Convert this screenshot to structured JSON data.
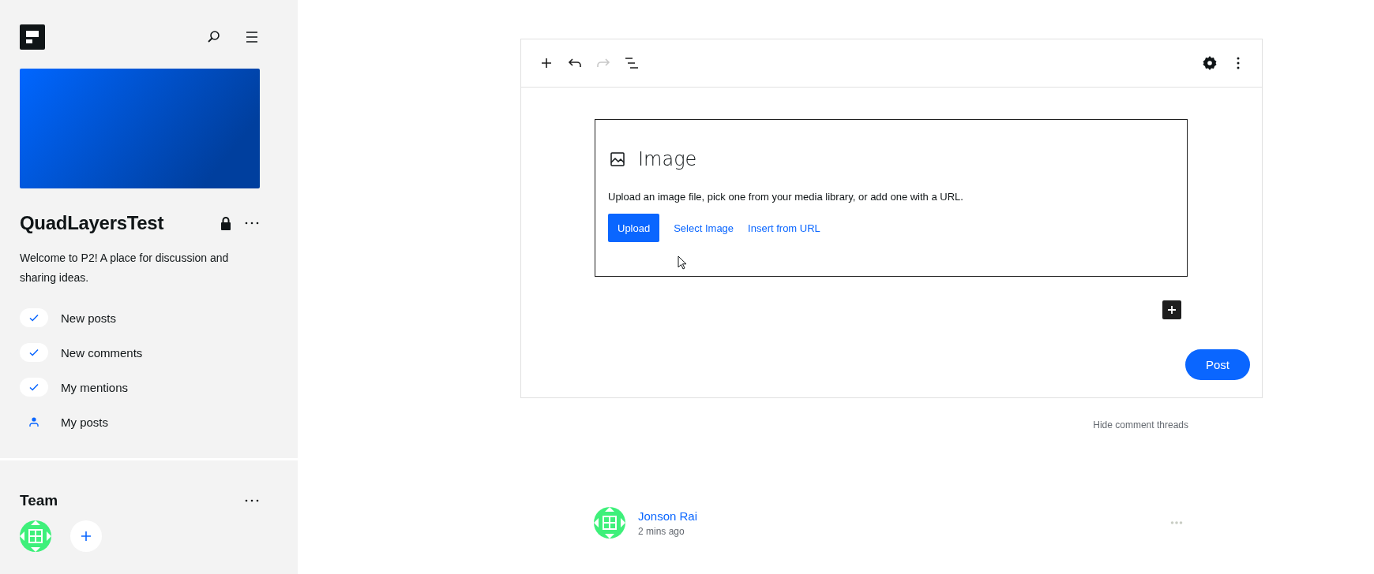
{
  "sidebar": {
    "site_title": "QuadLayersTest",
    "private": true,
    "description": "Welcome to P2! A place for discussion and sharing ideas.",
    "filters": [
      {
        "kind": "check",
        "label": "New posts",
        "checked": true
      },
      {
        "kind": "check",
        "label": "New comments",
        "checked": true
      },
      {
        "kind": "check",
        "label": "My mentions",
        "checked": true
      },
      {
        "kind": "person",
        "label": "My posts",
        "checked": false
      }
    ],
    "team": {
      "title": "Team",
      "members": [
        {
          "kind": "avatar",
          "color": "#3ef07a"
        }
      ]
    }
  },
  "editor": {
    "toolbar": [
      {
        "kind": "add",
        "disabled": false
      },
      {
        "kind": "undo",
        "disabled": false
      },
      {
        "kind": "redo",
        "disabled": true
      },
      {
        "kind": "outline",
        "disabled": false
      }
    ],
    "block": {
      "title": "Image",
      "instructions": "Upload an image file, pick one from your media library, or add one with a URL.",
      "upload_button": "Upload",
      "links": [
        "Select Image",
        "Insert from URL"
      ]
    },
    "post_button": "Post"
  },
  "hide_threads": "Hide comment threads",
  "comment": {
    "author": "Jonson Rai",
    "time": "2 mins ago"
  }
}
